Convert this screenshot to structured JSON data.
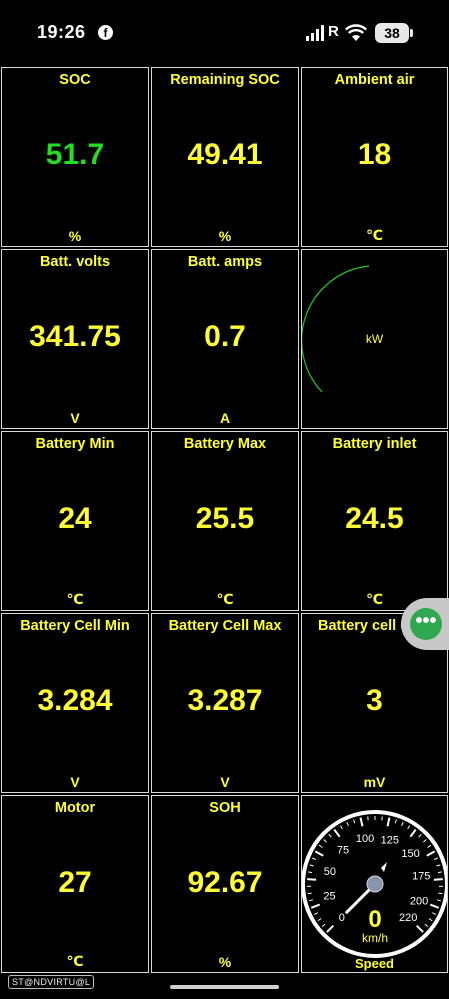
{
  "status_bar": {
    "time": "19:26",
    "roaming": "R",
    "battery": "38",
    "fb_glyph": "f"
  },
  "cells": [
    {
      "id": "soc",
      "label": "SOC",
      "value": "51.7",
      "unit": "%",
      "value_color": "#22dd22"
    },
    {
      "id": "remaining-soc",
      "label": "Remaining SOC",
      "value": "49.41",
      "unit": "%"
    },
    {
      "id": "ambient-air",
      "label": "Ambient air",
      "value": "18",
      "unit": "℃"
    },
    {
      "id": "batt-volts",
      "label": "Batt. volts",
      "value": "341.75",
      "unit": "V"
    },
    {
      "id": "batt-amps",
      "label": "Batt. amps",
      "value": "0.7",
      "unit": "A"
    },
    {
      "id": "power",
      "label": "",
      "value": "",
      "unit": "kW"
    },
    {
      "id": "battery-min",
      "label": "Battery Min",
      "value": "24",
      "unit": "℃"
    },
    {
      "id": "battery-max",
      "label": "Battery Max",
      "value": "25.5",
      "unit": "℃"
    },
    {
      "id": "battery-inlet",
      "label": "Battery inlet",
      "value": "24.5",
      "unit": "℃"
    },
    {
      "id": "battery-cell-min",
      "label": "Battery Cell Min",
      "value": "3.284",
      "unit": "V"
    },
    {
      "id": "battery-cell-max",
      "label": "Battery Cell Max",
      "value": "3.287",
      "unit": "V"
    },
    {
      "id": "battery-cell-diff",
      "label": "Battery cell d",
      "value": "3",
      "unit": "mV"
    },
    {
      "id": "motor",
      "label": "Motor",
      "value": "27",
      "unit": "℃"
    },
    {
      "id": "soh",
      "label": "SOH",
      "value": "92.67",
      "unit": "%"
    }
  ],
  "speed_gauge": {
    "label": "Speed",
    "unit": "km/h",
    "value": "0",
    "ticks": [
      "0",
      "25",
      "50",
      "75",
      "100",
      "125",
      "150",
      "175",
      "200",
      "220"
    ],
    "max": 220,
    "current": 0
  },
  "watermark": "ST@NDVIRTU@L",
  "float_button_glyph": "•••",
  "colors": {
    "label": "#ffff33",
    "soc_value": "#22dd22",
    "gauge_arc": "#22cc22",
    "float_button": "#2fa84f"
  }
}
